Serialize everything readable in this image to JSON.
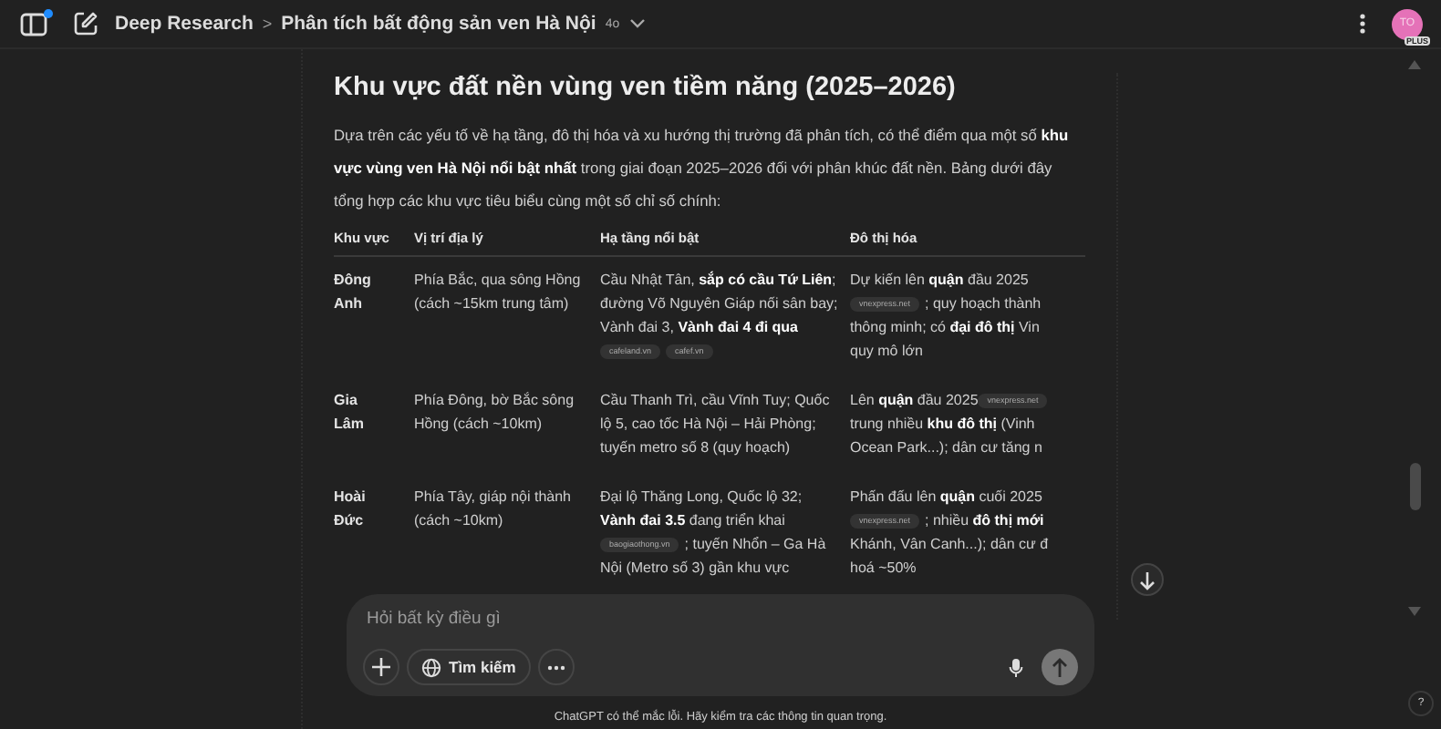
{
  "header": {
    "sidebar_notification": true,
    "project": "Deep Research",
    "separator": ">",
    "conversation": "Phân tích bất động sản ven Hà Nội",
    "model": "4o",
    "avatar": "TO",
    "plan": "PLUS"
  },
  "article": {
    "heading": "Khu vực đất nền vùng ven tiềm năng (2025–2026)",
    "intro": "Dựa trên các yếu tố về hạ tầng, đô thị hóa và xu hướng thị trường đã phân tích, có thể điểm qua một số **khu vực vùng ven Hà Nội nổi bật nhất** trong giai đoạn 2025–2026 đối với phân khúc đất nền. Bảng dưới đây tổng hợp các khu vực tiêu biểu cùng một số chỉ số chính:",
    "table": {
      "columns": [
        "Khu vực",
        "Vị trí địa lý",
        "Hạ tầng nổi bật",
        "Đô thị hóa"
      ],
      "rows": [
        {
          "cells": [
            [
              [
                {
                  "kind": "text",
                  "text": "Đông"
                }
              ],
              [
                {
                  "kind": "text",
                  "text": "Anh"
                }
              ]
            ],
            [
              [
                {
                  "kind": "text",
                  "text": "Phía Bắc, qua sông Hồng"
                }
              ],
              [
                {
                  "kind": "text",
                  "text": "(cách ~15km trung tâm)"
                }
              ]
            ],
            [
              [
                {
                  "kind": "text",
                  "text": "Cầu Nhật Tân, **sắp có cầu Tứ Liên**;"
                }
              ],
              [
                {
                  "kind": "text",
                  "text": "đường Võ Nguyên Giáp nối sân bay;"
                }
              ],
              [
                {
                  "kind": "text",
                  "text": "Vành đai 3, **Vành đai 4 đi qua**"
                }
              ],
              [
                {
                  "kind": "source",
                  "text": "cafeland.vn"
                },
                {
                  "kind": "source",
                  "text": "cafef.vn"
                }
              ]
            ],
            [
              [
                {
                  "kind": "text",
                  "text": "Dự kiến lên **quận** đầu 2025"
                }
              ],
              [
                {
                  "kind": "source",
                  "text": "vnexpress.net"
                },
                {
                  "kind": "text",
                  "text": "; quy hoạch thành"
                }
              ],
              [
                {
                  "kind": "text",
                  "text": "thông minh; có **đại đô thị** Vin"
                }
              ],
              [
                {
                  "kind": "text",
                  "text": "quy mô lớn"
                }
              ]
            ]
          ]
        },
        {
          "cells": [
            [
              [
                {
                  "kind": "text",
                  "text": "Gia"
                }
              ],
              [
                {
                  "kind": "text",
                  "text": "Lâm"
                }
              ]
            ],
            [
              [
                {
                  "kind": "text",
                  "text": "Phía Đông, bờ Bắc sông"
                }
              ],
              [
                {
                  "kind": "text",
                  "text": "Hồng (cách ~10km)"
                }
              ]
            ],
            [
              [
                {
                  "kind": "text",
                  "text": "Cầu Thanh Trì, cầu Vĩnh Tuy; Quốc"
                }
              ],
              [
                {
                  "kind": "text",
                  "text": "lộ 5, cao tốc Hà Nội – Hải Phòng;"
                }
              ],
              [
                {
                  "kind": "text",
                  "text": "tuyến metro số 8 (quy hoạch)"
                }
              ]
            ],
            [
              [
                {
                  "kind": "text",
                  "text": "Lên **quận** đầu 2025"
                },
                {
                  "kind": "source",
                  "text": "vnexpress.net"
                }
              ],
              [
                {
                  "kind": "text",
                  "text": "trung nhiều **khu đô thị** (Vinh"
                }
              ],
              [
                {
                  "kind": "text",
                  "text": "Ocean Park...); dân cư tăng n"
                }
              ]
            ]
          ]
        },
        {
          "cells": [
            [
              [
                {
                  "kind": "text",
                  "text": "Hoài"
                }
              ],
              [
                {
                  "kind": "text",
                  "text": "Đức"
                }
              ]
            ],
            [
              [
                {
                  "kind": "text",
                  "text": "Phía Tây, giáp nội thành"
                }
              ],
              [
                {
                  "kind": "text",
                  "text": "(cách ~10km)"
                }
              ]
            ],
            [
              [
                {
                  "kind": "text",
                  "text": "Đại lộ Thăng Long, Quốc lộ 32;"
                }
              ],
              [
                {
                  "kind": "text",
                  "text": "**Vành đai 3.5** đang triển khai"
                }
              ],
              [
                {
                  "kind": "source",
                  "text": "baogiaothong.vn"
                },
                {
                  "kind": "text",
                  "text": "; tuyến Nhổn – Ga Hà"
                }
              ],
              [
                {
                  "kind": "text",
                  "text": "Nội (Metro số 3) gần khu vực"
                }
              ]
            ],
            [
              [
                {
                  "kind": "text",
                  "text": "Phấn đấu lên **quận** cuối 2025"
                }
              ],
              [
                {
                  "kind": "source",
                  "text": "vnexpress.net"
                },
                {
                  "kind": "text",
                  "text": "; nhiều **đô thị mới**"
                }
              ],
              [
                {
                  "kind": "text",
                  "text": "Khánh, Vân Canh...); dân cư đ"
                }
              ],
              [
                {
                  "kind": "text",
                  "text": "hoá ~50%"
                }
              ]
            ]
          ]
        }
      ]
    }
  },
  "composer": {
    "placeholder": "Hỏi bất kỳ điều gì",
    "search_label": "Tìm kiếm"
  },
  "footer": "ChatGPT có thể mắc lỗi. Hãy kiểm tra các thông tin quan trọng.",
  "help": "?"
}
